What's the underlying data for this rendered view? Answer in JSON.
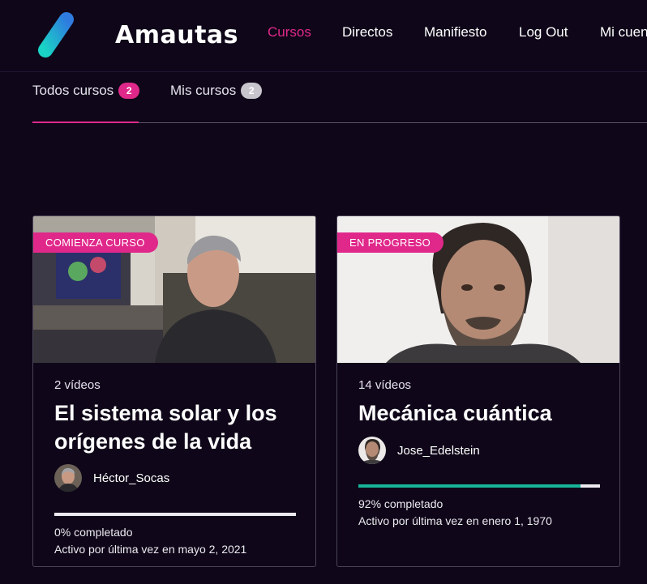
{
  "brand": {
    "name": "Amautas",
    "colors": {
      "accent": "#e0288a",
      "teal": "#17b49a",
      "background": "#0f0719"
    }
  },
  "nav": {
    "items": [
      {
        "label": "Cursos",
        "active": true
      },
      {
        "label": "Directos"
      },
      {
        "label": "Manifiesto"
      },
      {
        "label": "Log Out"
      },
      {
        "label": "Mi cuenta"
      }
    ]
  },
  "tabs": [
    {
      "label": "Todos cursos",
      "count": "2",
      "active": true
    },
    {
      "label": "Mis cursos",
      "count": "2"
    }
  ],
  "courses": [
    {
      "label": "COMIENZA CURSO",
      "videos": "2 vídeos",
      "title": "El sistema solar y los orígenes de la vida",
      "author": "Héctor_Socas",
      "progress_fraction": 0.0,
      "progress_text": "0% completado",
      "activity": "Activo por última vez en mayo 2, 2021"
    },
    {
      "label": "EN PROGRESO",
      "videos": "14 vídeos",
      "title": "Mecánica cuántica",
      "author": "Jose_Edelstein",
      "progress_fraction": 0.92,
      "progress_text": "92% completado",
      "activity": "Activo por última vez en enero 1, 1970"
    }
  ]
}
